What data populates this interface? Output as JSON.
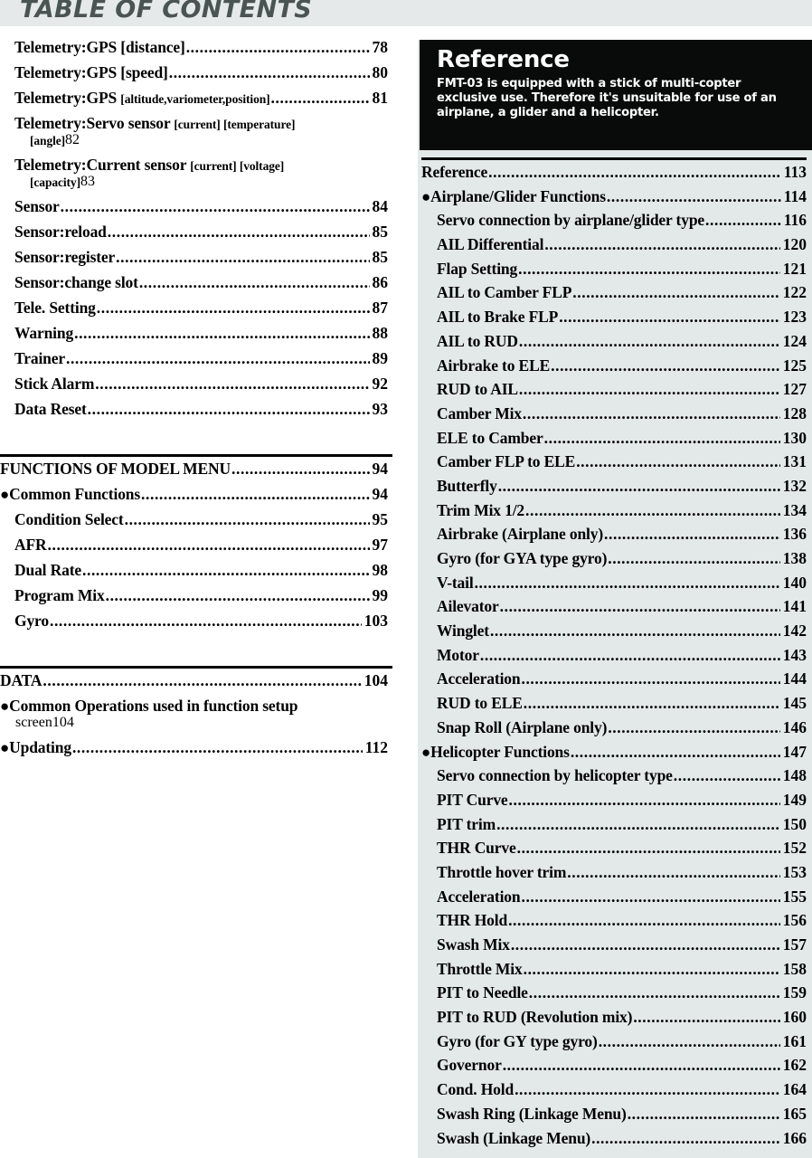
{
  "header": {
    "title": "TABLE OF CONTENTS",
    "band_color": "#e5e9e9",
    "title_color": "#4a5553"
  },
  "reference_box": {
    "title": "Reference",
    "note": "FMT-03 is equipped with a stick of multi-copter exclusive use. Therefore it's unsuitable for use of an airplane, a glider and a helicopter.",
    "background_color": "#090b0b",
    "text_color": "#ffffff"
  },
  "right_column": {
    "background_color": "#e3e8e8"
  },
  "left_column": {
    "groups": [
      {
        "rule_above": false,
        "entries": [
          {
            "level": "sub",
            "label": "Telemetry:GPS [distance]",
            "page": "78"
          },
          {
            "level": "sub",
            "label": "Telemetry:GPS [speed]",
            "page": "80"
          },
          {
            "level": "sub",
            "label": "Telemetry:GPS ",
            "label_small": "[altitude,variometer,position]",
            "page": "81"
          },
          {
            "level": "sub",
            "wrapped": true,
            "line1": "Telemetry:Servo sensor ",
            "line1_small": "[current] [temperature]",
            "line2_small": "[angle]",
            "page": "82"
          },
          {
            "level": "sub",
            "wrapped": true,
            "line1": "Telemetry:Current sensor ",
            "line1_small": "[current] [voltage]",
            "line2_small": "[capacity]",
            "page": "83"
          },
          {
            "level": "sub",
            "label": "Sensor",
            "page": "84"
          },
          {
            "level": "sub",
            "label": "Sensor:reload",
            "page": "85"
          },
          {
            "level": "sub",
            "label": "Sensor:register",
            "page": "85"
          },
          {
            "level": "sub",
            "label": "Sensor:change slot",
            "page": "86"
          },
          {
            "level": "sub",
            "label": "Tele. Setting",
            "page": "87"
          },
          {
            "level": "sub",
            "label": "Warning",
            "page": "88"
          },
          {
            "level": "sub",
            "label": "Trainer",
            "page": "89"
          },
          {
            "level": "sub",
            "label": "Stick Alarm",
            "page": "92"
          },
          {
            "level": "sub",
            "label": "Data Reset",
            "page": "93"
          }
        ]
      },
      {
        "rule_above": true,
        "entries": [
          {
            "level": "head",
            "label": "FUNCTIONS OF MODEL MENU",
            "page": "94"
          },
          {
            "level": "bullet",
            "bullet": "●",
            "label": "Common Functions",
            "page": "94"
          },
          {
            "level": "sub",
            "label": "Condition Select",
            "page": "95"
          },
          {
            "level": "sub",
            "label": "AFR ",
            "page": "97"
          },
          {
            "level": "sub",
            "label": "Dual Rate",
            "page": "98"
          },
          {
            "level": "sub",
            "label": "Program Mix",
            "page": "99"
          },
          {
            "level": "sub",
            "label": "Gyro",
            "page": "103"
          }
        ]
      },
      {
        "rule_above": true,
        "entries": [
          {
            "level": "head",
            "label": "DATA",
            "page": "104"
          },
          {
            "level": "bullet",
            "bullet": "●",
            "wrapped": true,
            "line1": "Common Operations used in function setup",
            "line2": "screen",
            "page": "104"
          },
          {
            "level": "bullet",
            "bullet": "●",
            "label": "Updating",
            "page": "112"
          }
        ]
      }
    ]
  },
  "right_column_toc": {
    "groups": [
      {
        "rule_above": true,
        "entries": [
          {
            "level": "head",
            "label": "Reference",
            "page": "113"
          },
          {
            "level": "bullet",
            "bullet": "●",
            "label": "Airplane/Glider Functions",
            "page": "114"
          },
          {
            "level": "sub",
            "label": "Servo connection by airplane/glider type",
            "page": "116"
          },
          {
            "level": "sub",
            "label": "AIL Differential",
            "page": "120"
          },
          {
            "level": "sub",
            "label": "Flap Setting",
            "page": "121"
          },
          {
            "level": "sub",
            "label": "AIL to Camber FLP",
            "page": "122"
          },
          {
            "level": "sub",
            "label": "AIL to Brake FLP",
            "page": "123"
          },
          {
            "level": "sub",
            "label": "AIL to RUD",
            "page": "124"
          },
          {
            "level": "sub",
            "label": "Airbrake to ELE",
            "page": "125"
          },
          {
            "level": "sub",
            "label": "RUD to AIL",
            "page": "127"
          },
          {
            "level": "sub",
            "label": "Camber Mix",
            "page": "128"
          },
          {
            "level": "sub",
            "label": "ELE to Camber",
            "page": "130"
          },
          {
            "level": "sub",
            "label": "Camber FLP to ELE",
            "page": "131"
          },
          {
            "level": "sub",
            "label": "Butterfly",
            "page": "132"
          },
          {
            "level": "sub",
            "label": "Trim Mix 1/2",
            "page": "134"
          },
          {
            "level": "sub",
            "label": "Airbrake (Airplane only)",
            "page": "136"
          },
          {
            "level": "sub",
            "label": "Gyro (for GYA type gyro)",
            "page": "138"
          },
          {
            "level": "sub",
            "label": "V-tail",
            "page": "140"
          },
          {
            "level": "sub",
            "label": "Ailevator",
            "page": "141"
          },
          {
            "level": "sub",
            "label": "Winglet",
            "page": "142"
          },
          {
            "level": "sub",
            "label": "Motor",
            "page": "143"
          },
          {
            "level": "sub",
            "label": "Acceleration",
            "page": "144"
          },
          {
            "level": "sub",
            "label": "RUD to ELE",
            "page": "145"
          },
          {
            "level": "sub",
            "label": "Snap Roll (Airplane only)",
            "page": "146"
          },
          {
            "level": "bullet",
            "bullet": "●",
            "label": "Helicopter Functions",
            "page": "147"
          },
          {
            "level": "sub",
            "label": "Servo connection by helicopter type",
            "page": "148"
          },
          {
            "level": "sub",
            "label": "PIT Curve",
            "page": "149"
          },
          {
            "level": "sub",
            "label": "PIT trim",
            "page": "150"
          },
          {
            "level": "sub",
            "label": "THR Curve",
            "page": "152"
          },
          {
            "level": "sub",
            "label": "Throttle hover trim",
            "page": "153"
          },
          {
            "level": "sub",
            "label": "Acceleration",
            "page": "155"
          },
          {
            "level": "sub",
            "label": "THR Hold",
            "page": "156"
          },
          {
            "level": "sub",
            "label": "Swash Mix",
            "page": "157"
          },
          {
            "level": "sub",
            "label": "Throttle Mix",
            "page": "158"
          },
          {
            "level": "sub",
            "label": "PIT to Needle",
            "page": "159"
          },
          {
            "level": "sub",
            "label": "PIT to RUD (Revolution mix)",
            "page": "160"
          },
          {
            "level": "sub",
            "label": "Gyro (for GY type gyro)",
            "page": "161"
          },
          {
            "level": "sub",
            "label": "Governor",
            "page": "162"
          },
          {
            "level": "sub",
            "label": "Cond. Hold",
            "page": "164"
          },
          {
            "level": "sub",
            "label": "Swash Ring (Linkage Menu)",
            "page": "165"
          },
          {
            "level": "sub",
            "label": "Swash (Linkage Menu)",
            "page": "166"
          }
        ]
      }
    ]
  }
}
